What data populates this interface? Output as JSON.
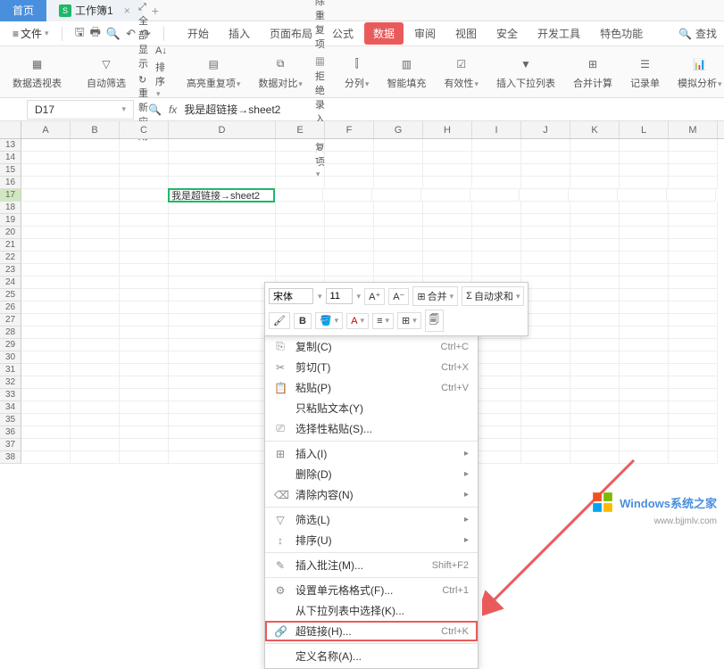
{
  "title_tabs": {
    "home": "首页",
    "doc": "工作簿1"
  },
  "menu": {
    "file": "文件",
    "tabs": [
      "开始",
      "插入",
      "页面布局",
      "公式",
      "数据",
      "审阅",
      "视图",
      "安全",
      "开发工具",
      "特色功能"
    ],
    "active_index": 4,
    "search": "查找"
  },
  "ribbon": {
    "pivot": "数据透视表",
    "autofilter": "自动筛选",
    "showall": "全部显示",
    "reapply": "重新应用",
    "sort": "排序",
    "highlight_dup": "高亮重复项",
    "data_compare": "数据对比",
    "remove_dup": "删除重复项",
    "reject_dup": "拒绝录入重复项",
    "split_col": "分列",
    "smart_fill": "智能填充",
    "validation": "有效性",
    "insert_dropdown": "插入下拉列表",
    "consolidate": "合并计算",
    "record_form": "记录单",
    "sim_analysis": "模拟分析"
  },
  "name_box": "D17",
  "formula": "我是超链接→sheet2",
  "columns": [
    "A",
    "B",
    "C",
    "D",
    "E",
    "F",
    "G",
    "H",
    "I",
    "J",
    "K",
    "L",
    "M"
  ],
  "rows_start": 13,
  "rows_end": 38,
  "active_row": 17,
  "cell_value": "我是超链接→sheet2",
  "mini_toolbar": {
    "font": "宋体",
    "size": "11",
    "merge": "合并",
    "autosum": "自动求和"
  },
  "context_menu": [
    {
      "icon": "⎘",
      "label": "复制(C)",
      "shortcut": "Ctrl+C"
    },
    {
      "icon": "✂",
      "label": "剪切(T)",
      "shortcut": "Ctrl+X"
    },
    {
      "icon": "📋",
      "label": "粘贴(P)",
      "shortcut": "Ctrl+V"
    },
    {
      "icon": "",
      "label": "只粘贴文本(Y)",
      "shortcut": ""
    },
    {
      "icon": "⎚",
      "label": "选择性粘贴(S)...",
      "shortcut": ""
    },
    {
      "sep": true
    },
    {
      "icon": "⊞",
      "label": "插入(I)",
      "shortcut": "",
      "arrow": true
    },
    {
      "icon": "",
      "label": "删除(D)",
      "shortcut": "",
      "arrow": true
    },
    {
      "icon": "⌫",
      "label": "清除内容(N)",
      "shortcut": "",
      "arrow": true
    },
    {
      "sep": true
    },
    {
      "icon": "▽",
      "label": "筛选(L)",
      "shortcut": "",
      "arrow": true
    },
    {
      "icon": "↕",
      "label": "排序(U)",
      "shortcut": "",
      "arrow": true
    },
    {
      "sep": true
    },
    {
      "icon": "✎",
      "label": "插入批注(M)...",
      "shortcut": "Shift+F2"
    },
    {
      "sep": true
    },
    {
      "icon": "⚙",
      "label": "设置单元格格式(F)...",
      "shortcut": "Ctrl+1"
    },
    {
      "icon": "",
      "label": "从下拉列表中选择(K)...",
      "shortcut": ""
    },
    {
      "icon": "🔗",
      "label": "超链接(H)...",
      "shortcut": "Ctrl+K",
      "highlighted": true
    },
    {
      "sep": true
    },
    {
      "icon": "",
      "label": "定义名称(A)...",
      "shortcut": ""
    }
  ],
  "watermark": {
    "text": "Windows系统之家",
    "url": "www.bjjmlv.com"
  }
}
